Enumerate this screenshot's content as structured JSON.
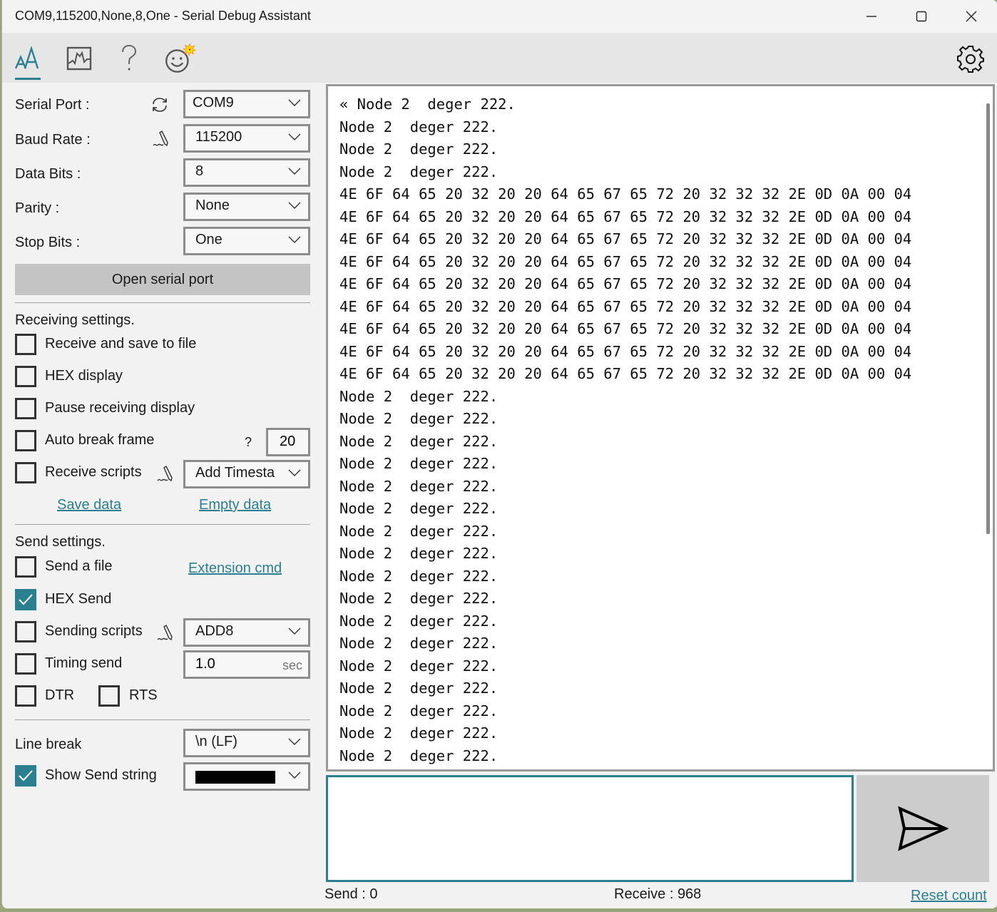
{
  "window": {
    "title": "COM9,115200,None,8,One - Serial Debug Assistant",
    "controls": [
      "minimize",
      "maximize",
      "close"
    ]
  },
  "toolbar": {
    "tabs": [
      {
        "name": "text-mode",
        "icon": "font-size-icon",
        "active": true
      },
      {
        "name": "chart-mode",
        "icon": "waveform-chart-icon",
        "active": false
      },
      {
        "name": "help",
        "icon": "question-icon",
        "active": false
      },
      {
        "name": "about",
        "icon": "smiley-icon",
        "active": false
      }
    ],
    "settings_icon": "gear-icon"
  },
  "serial": {
    "port_label": "Serial Port :",
    "port_value": "COM9",
    "baud_label": "Baud Rate :",
    "baud_value": "115200",
    "databits_label": "Data Bits :",
    "databits_value": "8",
    "parity_label": "Parity :",
    "parity_value": "None",
    "stopbits_label": "Stop Bits :",
    "stopbits_value": "One",
    "open_button": "Open serial port"
  },
  "receiving": {
    "heading": "Receiving settings.",
    "save_to_file": {
      "label": "Receive and save to file",
      "checked": false
    },
    "hex_display": {
      "label": "HEX display",
      "checked": false
    },
    "pause_display": {
      "label": "Pause receiving display",
      "checked": false
    },
    "auto_break": {
      "label": "Auto break frame",
      "checked": false,
      "help": "?",
      "value": "20"
    },
    "scripts": {
      "label": "Receive scripts",
      "checked": false,
      "value": "Add Timesta"
    },
    "save_data_link": "Save data",
    "empty_data_link": "Empty data"
  },
  "sending": {
    "heading": "Send settings.",
    "send_file": {
      "label": "Send a file",
      "checked": false
    },
    "extension_link": "Extension cmd",
    "hex_send": {
      "label": "HEX Send",
      "checked": true
    },
    "scripts": {
      "label": "Sending scripts",
      "checked": false,
      "value": "ADD8"
    },
    "timing": {
      "label": "Timing send",
      "checked": false,
      "value": "1.0",
      "unit": "sec"
    },
    "dtr": {
      "label": "DTR",
      "checked": false
    },
    "rts": {
      "label": "RTS",
      "checked": false
    },
    "line_break_label": "Line break",
    "line_break_value": "\\n (LF)",
    "show_send": {
      "label": "Show Send string",
      "checked": true,
      "color": "#000000"
    }
  },
  "receive_area": {
    "lines": [
      "« Node 2  deger 222.",
      "Node 2  deger 222.",
      "Node 2  deger 222.",
      "Node 2  deger 222.",
      "4E 6F 64 65 20 32 20 20 64 65 67 65 72 20 32 32 32 2E 0D 0A 00 04",
      "4E 6F 64 65 20 32 20 20 64 65 67 65 72 20 32 32 32 2E 0D 0A 00 04",
      "4E 6F 64 65 20 32 20 20 64 65 67 65 72 20 32 32 32 2E 0D 0A 00 04",
      "4E 6F 64 65 20 32 20 20 64 65 67 65 72 20 32 32 32 2E 0D 0A 00 04",
      "4E 6F 64 65 20 32 20 20 64 65 67 65 72 20 32 32 32 2E 0D 0A 00 04",
      "4E 6F 64 65 20 32 20 20 64 65 67 65 72 20 32 32 32 2E 0D 0A 00 04",
      "4E 6F 64 65 20 32 20 20 64 65 67 65 72 20 32 32 32 2E 0D 0A 00 04",
      "4E 6F 64 65 20 32 20 20 64 65 67 65 72 20 32 32 32 2E 0D 0A 00 04",
      "4E 6F 64 65 20 32 20 20 64 65 67 65 72 20 32 32 32 2E 0D 0A 00 04",
      "Node 2  deger 222.",
      "Node 2  deger 222.",
      "Node 2  deger 222.",
      "Node 2  deger 222.",
      "Node 2  deger 222.",
      "Node 2  deger 222.",
      "Node 2  deger 222.",
      "Node 2  deger 222.",
      "Node 2  deger 222.",
      "Node 2  deger 222.",
      "Node 2  deger 222.",
      "Node 2  deger 222.",
      "Node 2  deger 222.",
      "Node 2  deger 222.",
      "Node 2  deger 222.",
      "Node 2  deger 222.",
      "Node 2  deger 222."
    ]
  },
  "send_area": {
    "value": "",
    "send_icon": "send-icon"
  },
  "status": {
    "send_label": "Send :",
    "send_count": "0",
    "receive_label": "Receive :",
    "receive_count": "968",
    "reset_link": "Reset count"
  },
  "colors": {
    "accent": "#2a8090",
    "panel": "#f2f2f2",
    "toolbar": "#e6e6e6",
    "button": "#c4c4c4"
  }
}
